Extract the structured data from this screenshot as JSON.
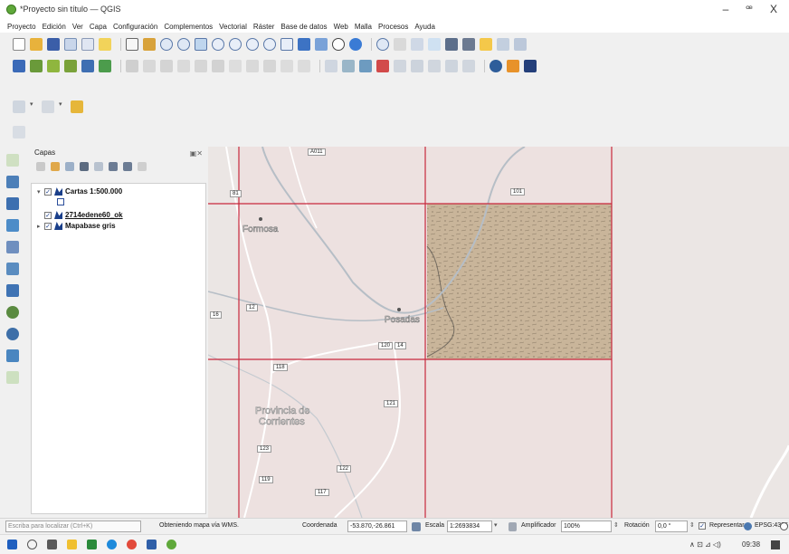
{
  "window": {
    "title": "*Proyecto sin título — QGIS",
    "minimize": "–",
    "restore": "ꟹ",
    "close": "X"
  },
  "menu": [
    "Proyecto",
    "Edición",
    "Ver",
    "Capa",
    "Configuración",
    "Complementos",
    "Vectorial",
    "Ráster",
    "Base de datos",
    "Web",
    "Malla",
    "Procesos",
    "Ayuda"
  ],
  "layers_panel": {
    "title": "Capas",
    "header_buttons": "▣✕",
    "layers": [
      {
        "label": "Cartas 1:500.000",
        "checked": true,
        "expanded": true
      },
      {
        "label": "2714edene60_ok",
        "checked": true,
        "underlined": true
      },
      {
        "label": "Mapabase gris",
        "checked": true,
        "expanded": false
      }
    ],
    "checkmark": "✓",
    "expand_open": "▾",
    "expand_closed": "▸"
  },
  "map": {
    "place_labels": [
      "Formosa",
      "Posadas",
      "Provincia de",
      "Corrientes"
    ],
    "road_shields": [
      "A011",
      "81",
      "101",
      "12",
      "16",
      "120",
      "14",
      "118",
      "121",
      "123",
      "119",
      "122",
      "117"
    ],
    "colors": {
      "background": "#ebe6e4",
      "grid": "#c8283c",
      "river": "#b6bec6",
      "road": "#ffffff",
      "raster": "#c9b59a"
    }
  },
  "statusbar": {
    "locator_placeholder": "Escriba para localizar (Ctrl+K)",
    "message": "Obteniendo mapa vía WMS.",
    "coord_label": "Coordenada",
    "coord_value": "-53.870,-26.861",
    "scale_label": "Escala",
    "scale_value": "1:2693834",
    "magnifier_label": "Amplificador",
    "magnifier_value": "100%",
    "rotation_label": "Rotación",
    "rotation_value": "0,0 °",
    "render_label": "Representar",
    "crs": "EPSG:4326"
  },
  "taskbar": {
    "clock": "09:38",
    "tray": "∧ ⊡ ⊿ ◁)"
  }
}
